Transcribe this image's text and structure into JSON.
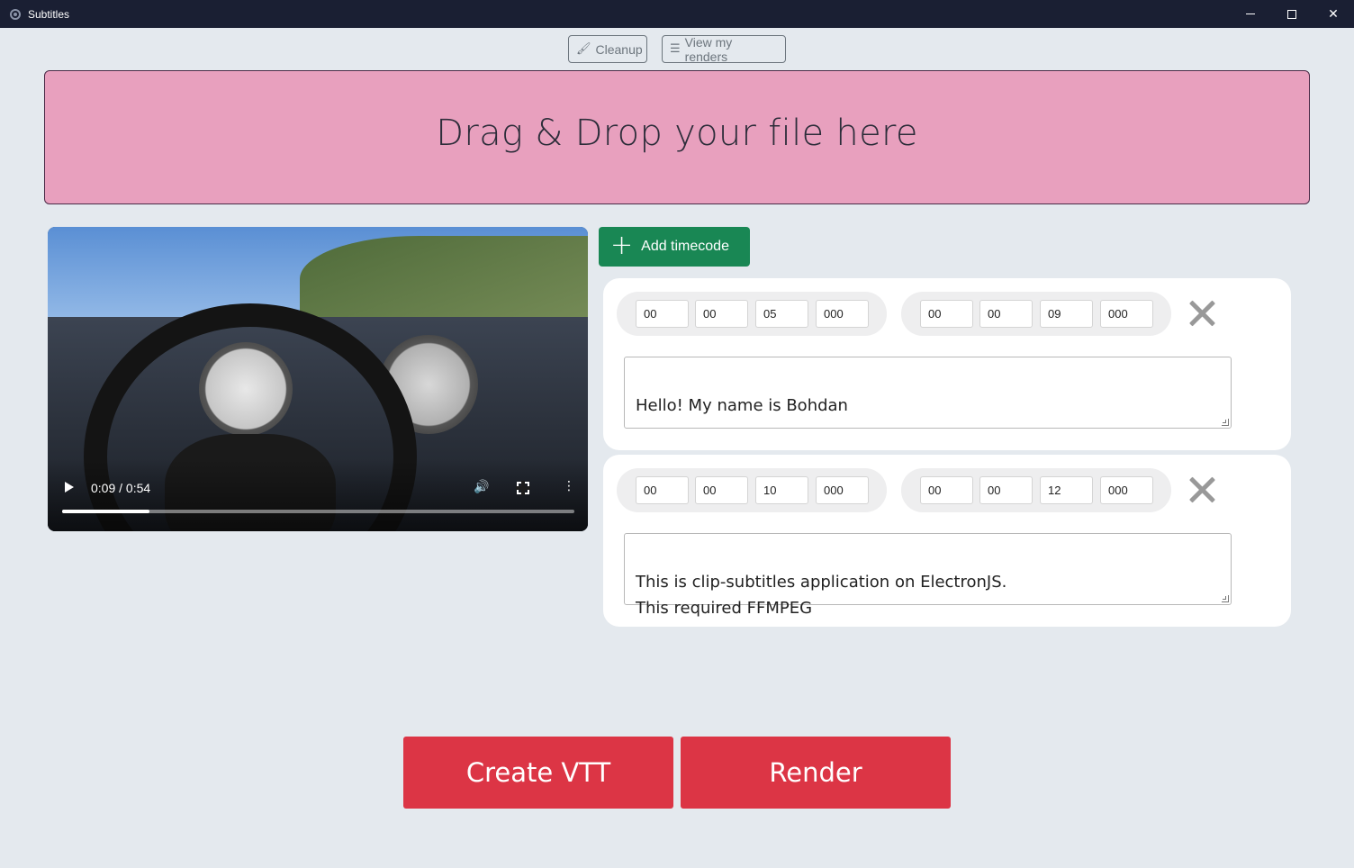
{
  "window": {
    "title": "Subtitles"
  },
  "toolbar": {
    "cleanup_label": "Cleanup",
    "renders_label": "View my renders"
  },
  "dropzone": {
    "label": "Drag & Drop your file here"
  },
  "video": {
    "time": "0:09 / 0:54",
    "progress": 0.17
  },
  "add_timecode": {
    "label": "Add timecode"
  },
  "timecodes": [
    {
      "start": [
        "00",
        "00",
        "05",
        "000"
      ],
      "end": [
        "00",
        "00",
        "09",
        "000"
      ],
      "text": "Hello! My name is Bohdan"
    },
    {
      "start": [
        "00",
        "00",
        "10",
        "000"
      ],
      "end": [
        "00",
        "00",
        "12",
        "000"
      ],
      "text": "This is clip-subtitles application on ElectronJS.\nThis required FFMPEG"
    }
  ],
  "actions": {
    "create_vtt_label": "Create VTT",
    "render_label": "Render"
  },
  "colors": {
    "dropzone": "#e8a0be",
    "add_button": "#198754",
    "action_button": "#dc3545",
    "title_bar": "#1a1f33",
    "background": "#e4e9ee"
  }
}
